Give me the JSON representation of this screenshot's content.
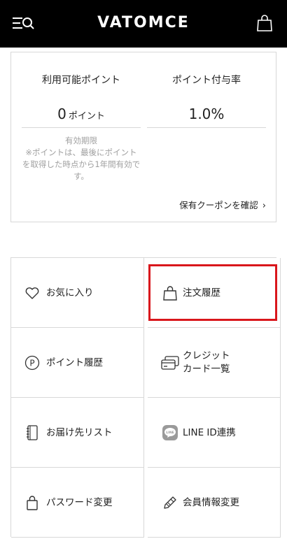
{
  "header": {
    "brand": "VATOMCE",
    "menu_icon": "menu-search-icon",
    "cart_icon": "shopping-bag-icon"
  },
  "points": {
    "available_label": "利用可能ポイント",
    "available_value": "0",
    "available_unit": "ポイント",
    "rate_label": "ポイント付与率",
    "rate_value": "1.0%",
    "expiry_title": "有効期限",
    "expiry_note": "※ポイントは、最後にポイントを取得した時点から1年間有効です。",
    "coupon_link": "保有クーポンを確認",
    "coupon_chevron": "›"
  },
  "menu": {
    "items": [
      {
        "label": "お気に入り",
        "icon": "heart-icon"
      },
      {
        "label": "注文履歴",
        "icon": "shopping-bag-icon"
      },
      {
        "label": "ポイント履歴",
        "icon": "point-circle-icon"
      },
      {
        "label": "クレジット\nカード一覧",
        "label_line1": "クレジット",
        "label_line2": "カード一覧",
        "icon": "credit-card-icon"
      },
      {
        "label": "お届け先リスト",
        "icon": "address-book-icon"
      },
      {
        "label": "LINE ID連携",
        "icon": "line-icon"
      },
      {
        "label": "パスワード変更",
        "icon": "lock-bag-icon"
      },
      {
        "label": "会員情報変更",
        "icon": "pencil-icon"
      }
    ]
  },
  "colors": {
    "header_bg": "#000000",
    "highlight": "#d9161c",
    "border": "#d8d8d8",
    "muted_text": "#a0a0a0"
  }
}
